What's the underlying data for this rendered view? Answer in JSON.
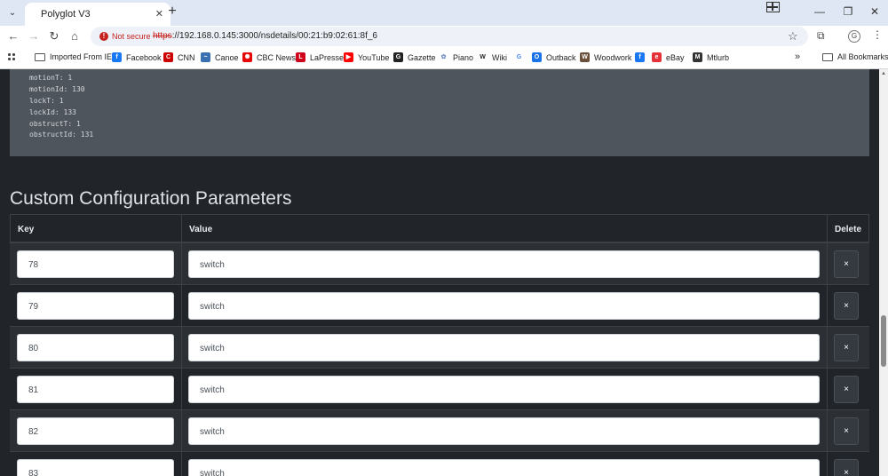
{
  "browser": {
    "tab_title": "Polyglot V3",
    "security_label": "Not secure",
    "url_scheme": "https",
    "url_rest": "://192.168.0.145:3000/nsdetails/00:21:b9:02:61:8f_6",
    "bookmarks": [
      {
        "label": "Imported From IE",
        "icon": "folder-icon"
      },
      {
        "label": "Facebook",
        "icon": "facebook-icon",
        "color": "#1877f2"
      },
      {
        "label": "CNN",
        "icon": "cnn-icon",
        "color": "#cc0000"
      },
      {
        "label": "Canoe",
        "icon": "canoe-icon",
        "color": "#3a6fb0"
      },
      {
        "label": "CBC News",
        "icon": "cbc-icon",
        "color": "#e60505"
      },
      {
        "label": "LaPresse",
        "icon": "lapresse-icon",
        "color": "#d0021b"
      },
      {
        "label": "YouTube",
        "icon": "youtube-icon",
        "color": "#ff0000"
      },
      {
        "label": "Gazette",
        "icon": "gazette-icon",
        "color": "#222222"
      },
      {
        "label": "Piano",
        "icon": "piano-icon",
        "color": "#6c8ebf"
      },
      {
        "label": "Wiki",
        "icon": "wikipedia-icon",
        "color": "#222222"
      },
      {
        "label": "",
        "icon": "google-icon",
        "color": "#4285f4"
      },
      {
        "label": "Outback",
        "icon": "outback-icon",
        "color": "#1a73e8"
      },
      {
        "label": "Woodwork",
        "icon": "woodwork-icon",
        "color": "#6b4f3a"
      },
      {
        "label": "",
        "icon": "facebook-icon",
        "color": "#1877f2"
      },
      {
        "label": "eBay",
        "icon": "ebay-icon",
        "color": "#e53238"
      },
      {
        "label": "Mtlurb",
        "icon": "mtlurb-icon",
        "color": "#333333"
      }
    ],
    "all_bookmarks": "All Bookmarks",
    "more_bookmarks": "»"
  },
  "code_lines": [
    "motionT: 1",
    "motionId: 130",
    "lockT: 1",
    "lockId: 133",
    "obstructT: 1",
    "obstructId: 131"
  ],
  "section_title": "Custom Configuration Parameters",
  "table": {
    "headers": {
      "key": "Key",
      "value": "Value",
      "delete": "Delete"
    },
    "rows": [
      {
        "key": "78",
        "value": "switch"
      },
      {
        "key": "79",
        "value": "switch"
      },
      {
        "key": "80",
        "value": "switch"
      },
      {
        "key": "81",
        "value": "switch"
      },
      {
        "key": "82",
        "value": "switch"
      },
      {
        "key": "83",
        "value": "switch"
      }
    ],
    "delete_label": "×"
  }
}
